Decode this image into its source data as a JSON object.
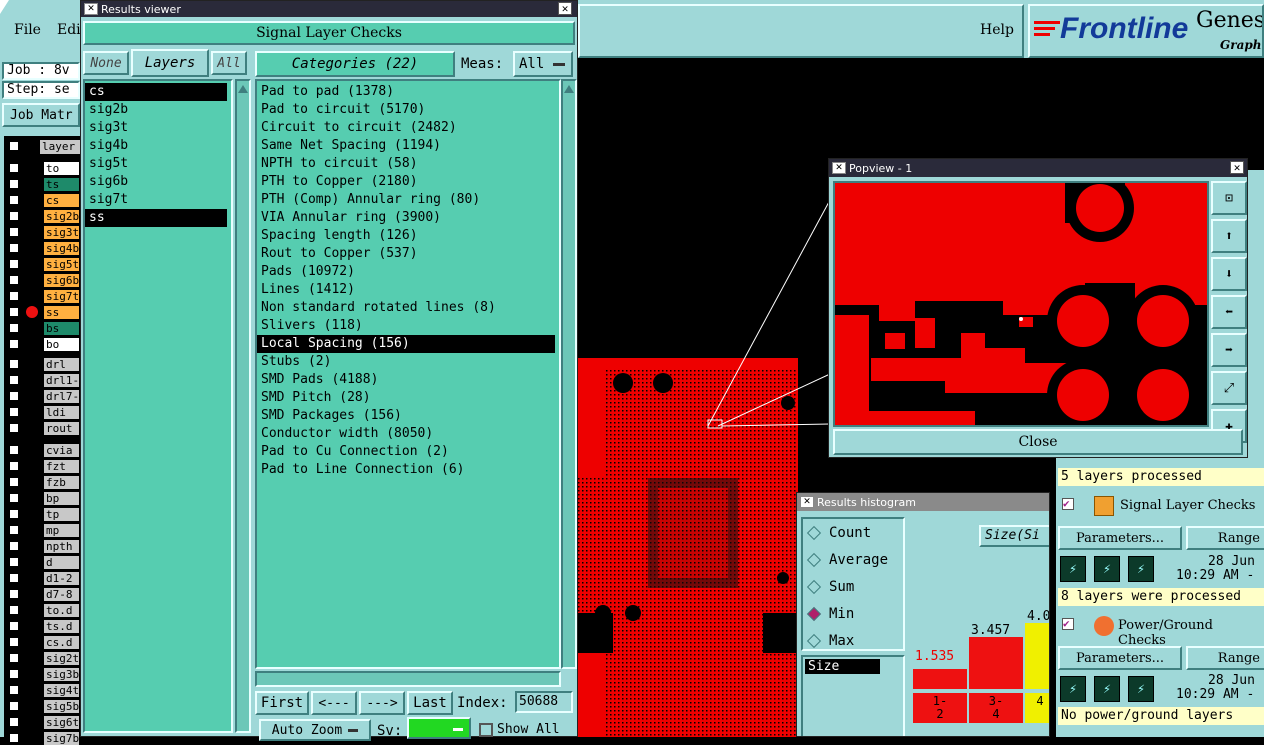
{
  "main_window": {
    "menu_file": "File",
    "menu_edit": "Edi",
    "menu_help": "Help",
    "brand": "Frontline",
    "product": "Genesi",
    "product_sub": "Graphi",
    "job_label": "Job : 8v",
    "step_label": "Step: se",
    "job_matrix": "Job Matr"
  },
  "layer_list": {
    "header": "layer",
    "group1": [
      {
        "name": "to",
        "color": "#ffffff"
      },
      {
        "name": "ts",
        "color": "#1e8a6a"
      },
      {
        "name": "cs",
        "color": "#ffb040"
      },
      {
        "name": "sig2b",
        "color": "#ffb040"
      },
      {
        "name": "sig3t",
        "color": "#ffb040"
      },
      {
        "name": "sig4b",
        "color": "#ffb040"
      },
      {
        "name": "sig5t",
        "color": "#ffb040"
      },
      {
        "name": "sig6b",
        "color": "#ffb040"
      },
      {
        "name": "sig7t",
        "color": "#ffb040"
      },
      {
        "name": "ss",
        "color": "#ffb040"
      },
      {
        "name": "bs",
        "color": "#1e8a6a"
      },
      {
        "name": "bo",
        "color": "#ffffff"
      }
    ],
    "group2": [
      {
        "name": "drl",
        "color": "#c8c8c8"
      },
      {
        "name": "drl1-",
        "color": "#c8c8c8"
      },
      {
        "name": "drl7-",
        "color": "#c8c8c8"
      },
      {
        "name": "ldi",
        "color": "#c8c8c8"
      },
      {
        "name": "rout",
        "color": "#c8c8c8"
      }
    ],
    "group3": [
      {
        "name": "cvia",
        "color": "#c8c8c8"
      },
      {
        "name": "fzt",
        "color": "#c8c8c8"
      },
      {
        "name": "fzb",
        "color": "#c8c8c8"
      },
      {
        "name": "bp",
        "color": "#c8c8c8"
      },
      {
        "name": "tp",
        "color": "#c8c8c8"
      },
      {
        "name": "mp",
        "color": "#c8c8c8"
      },
      {
        "name": "npth",
        "color": "#c8c8c8"
      },
      {
        "name": "d",
        "color": "#c8c8c8"
      },
      {
        "name": "d1-2",
        "color": "#c8c8c8"
      },
      {
        "name": "d7-8",
        "color": "#c8c8c8"
      },
      {
        "name": "to.d",
        "color": "#c8c8c8"
      },
      {
        "name": "ts.d",
        "color": "#c8c8c8"
      },
      {
        "name": "cs.d",
        "color": "#c8c8c8"
      },
      {
        "name": "sig2t",
        "color": "#c8c8c8"
      },
      {
        "name": "sig3b",
        "color": "#c8c8c8"
      },
      {
        "name": "sig4t",
        "color": "#c8c8c8"
      },
      {
        "name": "sig5b",
        "color": "#c8c8c8"
      },
      {
        "name": "sig6t",
        "color": "#c8c8c8"
      },
      {
        "name": "sig7b",
        "color": "#c8c8c8"
      }
    ]
  },
  "results_viewer": {
    "title": "Results viewer",
    "header": "Signal Layer Checks",
    "btn_none": "None",
    "btn_layers": "Layers",
    "btn_all": "All",
    "categories_label": "Categories (22)",
    "meas_label": "Meas:",
    "meas_value": "All",
    "layers": [
      "cs",
      "sig2b",
      "sig3t",
      "sig4b",
      "sig5t",
      "sig6b",
      "sig7t",
      "ss"
    ],
    "categories": [
      "Pad to pad (1378)",
      "Pad to circuit (5170)",
      "Circuit to circuit (2482)",
      "Same Net Spacing (1194)",
      "NPTH to circuit (58)",
      "PTH to Copper (2180)",
      "PTH (Comp) Annular ring (80)",
      "VIA Annular ring (3900)",
      "Spacing length (126)",
      "Rout to Copper (537)",
      "Pads (10972)",
      "Lines (1412)",
      "Non standard rotated lines (8)",
      "Slivers (118)",
      "Local Spacing (156)",
      "Stubs (2)",
      "SMD Pads (4188)",
      "SMD Pitch (28)",
      "SMD Packages (156)",
      "Conductor width (8050)",
      "Pad to Cu Connection (2)",
      "Pad to Line Connection (6)"
    ],
    "selected_category": "Local Spacing (156)",
    "btn_first": "First",
    "btn_prev": "<---",
    "btn_next": "--->",
    "btn_last": "Last",
    "index_label": "Index:",
    "index_value": "50688",
    "auto_zoom": "Auto Zoom",
    "sv_label": "Sv:",
    "show_all": "Show All"
  },
  "popview": {
    "title": "Popview - 1",
    "close": "Close"
  },
  "histogram": {
    "title": "Results histogram",
    "options": [
      "Count",
      "Average",
      "Sum",
      "Min",
      "Max"
    ],
    "selected_option": "Min",
    "size_list_item": "Size",
    "size_tab": "Size(Si",
    "bars": [
      {
        "value": "1.535",
        "range_top": "1-",
        "range_bot": "2"
      },
      {
        "value": "3.457",
        "range_top": "3-",
        "range_bot": "4"
      },
      {
        "value": "4.0",
        "range_top": "4",
        "range_bot": ""
      }
    ]
  },
  "checks_panel": {
    "status1": "5 layers processed",
    "signal_checks": "Signal Layer Checks",
    "parameters": "Parameters...",
    "ranges": "Range",
    "date1": "28 Jun",
    "time1": "10:29 AM -",
    "status2": "8 layers were processed",
    "power_checks": "Power/Ground Checks",
    "date2": "28 Jun",
    "time2": "10:29 AM -",
    "status3": "No power/ground layers"
  }
}
